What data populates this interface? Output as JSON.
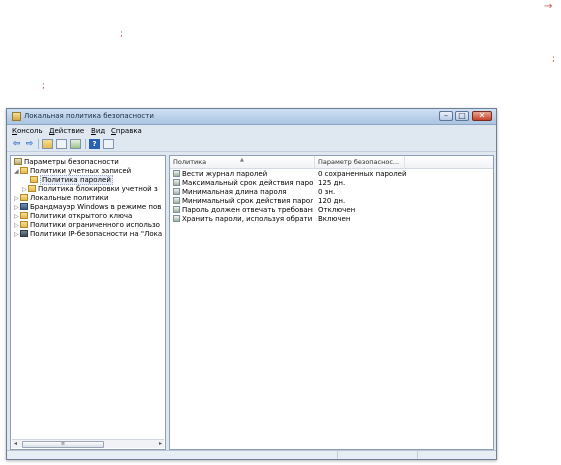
{
  "stray_marks": [
    "→",
    ";",
    ";",
    ";"
  ],
  "window": {
    "title": "Локальная политика безопасности",
    "controls": {
      "minimize": "–",
      "maximize": "□",
      "close": "✕"
    }
  },
  "menu": [
    {
      "label": "Консоль",
      "accel_pre": "",
      "accel": "К",
      "rest": "онсоль"
    },
    {
      "label": "Действие",
      "accel_pre": "",
      "accel": "Д",
      "rest": "ействие"
    },
    {
      "label": "Вид",
      "accel_pre": "",
      "accel": "В",
      "rest": "ид"
    },
    {
      "label": "Справка",
      "accel_pre": "",
      "accel": "С",
      "rest": "правка"
    }
  ],
  "toolbar": {
    "back_icon": "back-arrow-icon",
    "forward_icon": "forward-arrow-icon",
    "help_glyph": "?"
  },
  "tree": [
    {
      "label": "Параметры безопасности",
      "icon": "security-settings-icon",
      "expander": ""
    },
    {
      "label": "Политики учетных записей",
      "icon": "folder-icon",
      "expander": "◢"
    },
    {
      "label": "Политика паролей",
      "icon": "folder-icon",
      "expander": ""
    },
    {
      "label": "Политика блокировки учетной з",
      "icon": "folder-icon",
      "expander": "▷"
    },
    {
      "label": "Локальные политики",
      "icon": "folder-icon",
      "expander": "▷"
    },
    {
      "label": "Брандмауэр Windows в режиме пов",
      "icon": "firewall-icon",
      "expander": "▷"
    },
    {
      "label": "Политики открытого ключа",
      "icon": "folder-icon",
      "expander": "▷"
    },
    {
      "label": "Политики ограниченного использо",
      "icon": "folder-icon",
      "expander": "▷"
    },
    {
      "label": "Политики IP-безопасности на \"Лока",
      "icon": "ip-security-icon",
      "expander": "▷"
    }
  ],
  "tree_scroll": {
    "left": "◂",
    "right": "▸",
    "thumb": "≡"
  },
  "list": {
    "columns": [
      "Политика",
      "Параметр безопаснос..."
    ],
    "rows": [
      {
        "policy": "Вести журнал паролей",
        "value": "0 сохраненных паролей"
      },
      {
        "policy": "Максимальный срок действия паро...",
        "value": "125 дн."
      },
      {
        "policy": "Минимальная длина пароля",
        "value": "0 зн."
      },
      {
        "policy": "Минимальный срок действия пароля",
        "value": "120 дн."
      },
      {
        "policy": "Пароль должен отвечать требовани...",
        "value": "Отключен"
      },
      {
        "policy": "Хранить пароли, используя обрати...",
        "value": "Включен"
      }
    ]
  }
}
